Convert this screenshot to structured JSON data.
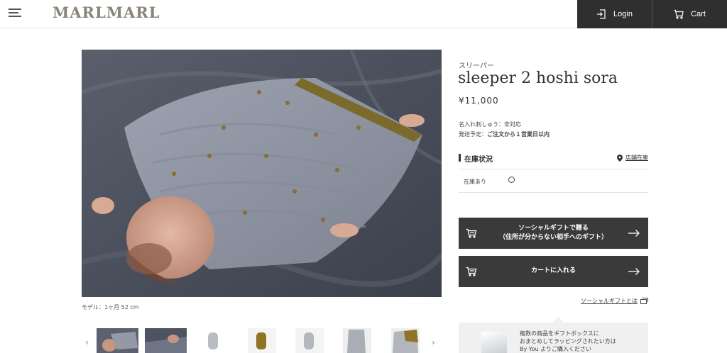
{
  "header": {
    "logo": "MARLMARL",
    "login_label": "Login",
    "cart_label": "Cart"
  },
  "product": {
    "category": "スリーパー",
    "name": "sleeper 2 hoshi sora",
    "price": "¥11,000",
    "embroidery": "名入れ刺しゅう：非対応",
    "ship_prefix": "発送予定：",
    "ship_value": "ご注文から１営業日以内",
    "model_note": "モデル：1ヶ月 52 cm"
  },
  "stock": {
    "title": "在庫状況",
    "store_link": "店舗在庫",
    "row_label": "在庫あり",
    "row_value": "○"
  },
  "actions": {
    "social_gift_line1": "ソーシャルギフトで贈る",
    "social_gift_line2": "（住所が分からない相手へのギフト）",
    "add_to_cart": "カートに入れる",
    "social_gift_about": "ソーシャルギフトとは"
  },
  "gift_box": {
    "line1": "複数の商品をギフトボックスに",
    "line2": "おまとめしてラッピングされたい方は",
    "line3": "By You よりご購入ください"
  },
  "thumbnails": {
    "prev": "‹",
    "next": "›"
  },
  "colors": {
    "header_dark": "#2f2f2f",
    "button_dark": "#3a3a3a",
    "logo": "#8a8478"
  }
}
